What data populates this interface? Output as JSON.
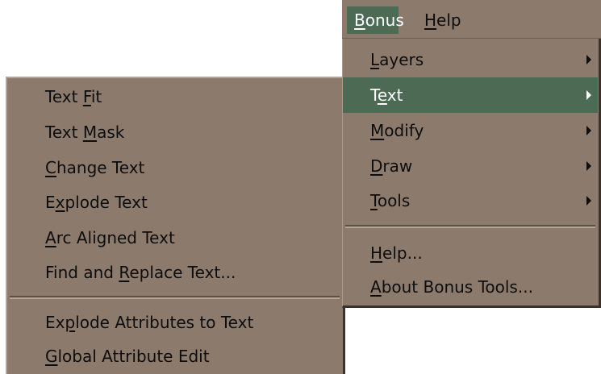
{
  "menubar": {
    "items": [
      {
        "pre": "",
        "acc": "B",
        "post": "onus",
        "active": true
      },
      {
        "pre": "",
        "acc": "H",
        "post": "elp",
        "active": false
      }
    ]
  },
  "bonus_menu": {
    "items": [
      {
        "pre": "",
        "acc": "L",
        "post": "ayers",
        "has_submenu": true
      },
      {
        "pre": "T",
        "acc": "e",
        "post": "xt",
        "has_submenu": true,
        "highlighted": true
      },
      {
        "pre": "",
        "acc": "M",
        "post": "odify",
        "has_submenu": true
      },
      {
        "pre": "",
        "acc": "D",
        "post": "raw",
        "has_submenu": true
      },
      {
        "pre": "",
        "acc": "T",
        "post": "ools",
        "has_submenu": true
      },
      {
        "pre": "",
        "acc": "H",
        "post": "elp...",
        "has_submenu": false
      },
      {
        "pre": "",
        "acc": "A",
        "post": "bout Bonus Tools...",
        "has_submenu": false
      }
    ]
  },
  "text_submenu": {
    "items": [
      {
        "pre": "Text ",
        "acc": "F",
        "post": "it"
      },
      {
        "pre": "Text ",
        "acc": "M",
        "post": "ask"
      },
      {
        "pre": "",
        "acc": "C",
        "post": "hange Text"
      },
      {
        "pre": "E",
        "acc": "x",
        "post": "plode Text"
      },
      {
        "pre": "",
        "acc": "A",
        "post": "rc Aligned Text"
      },
      {
        "pre": "Find and ",
        "acc": "R",
        "post": "eplace Text..."
      },
      {
        "pre": "Ex",
        "acc": "p",
        "post": "lode Attributes to Text"
      },
      {
        "pre": "",
        "acc": "G",
        "post": "lobal Attribute Edit"
      }
    ]
  },
  "colors": {
    "menu_bg": "#8c7b6c",
    "highlight_bg": "#4d6a55",
    "text": "#0d0d0d",
    "highlight_text": "#ffffff"
  }
}
